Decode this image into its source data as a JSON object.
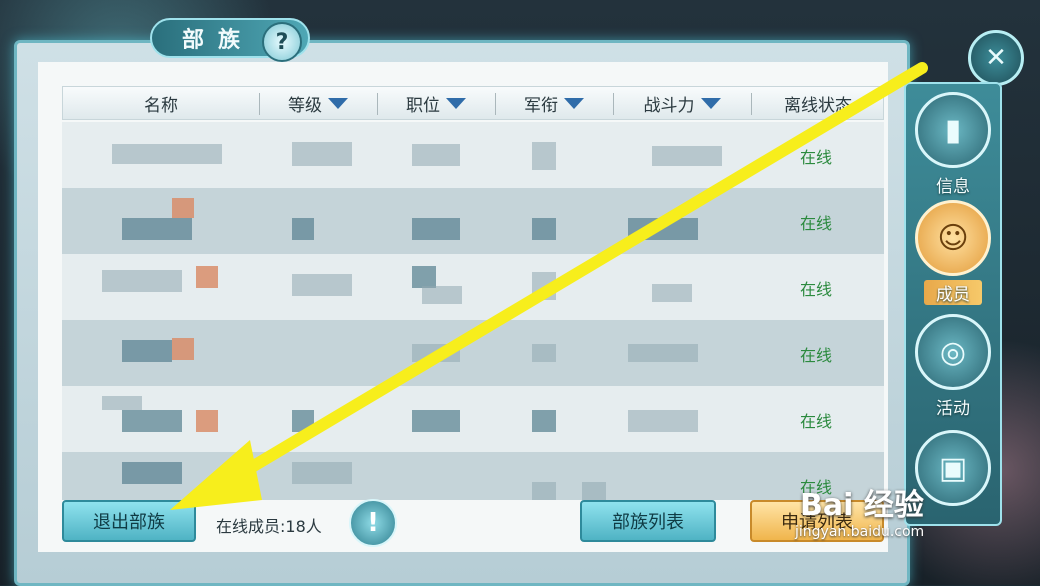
{
  "window": {
    "title": "部族",
    "help_icon": "?"
  },
  "table": {
    "headers": [
      {
        "label": "名称",
        "sortable": false
      },
      {
        "label": "等级",
        "sortable": true
      },
      {
        "label": "职位",
        "sortable": true
      },
      {
        "label": "军衔",
        "sortable": true
      },
      {
        "label": "战斗力",
        "sortable": true
      },
      {
        "label": "离线状态",
        "sortable": false
      }
    ],
    "rows": [
      {
        "status": "在线"
      },
      {
        "status": "在线"
      },
      {
        "status": "在线"
      },
      {
        "status": "在线"
      },
      {
        "status": "在线"
      },
      {
        "status": "在线"
      }
    ]
  },
  "bottom": {
    "leave_button": "退出部族",
    "online_count": "在线成员:18人",
    "info_icon": "!",
    "tribe_list_button": "部族列表",
    "apply_list_button": "申请列表"
  },
  "side_tabs": [
    {
      "label": "信息",
      "icon": "info-tab-icon",
      "active": false
    },
    {
      "label": "成员",
      "icon": "members-tab-icon",
      "active": true
    },
    {
      "label": "活动",
      "icon": "activity-tab-icon",
      "active": false
    },
    {
      "label": "",
      "icon": "gift-tab-icon",
      "active": false
    }
  ],
  "watermark": {
    "brand": "Bai 经验",
    "url": "jingyan.baidu.com"
  },
  "colors": {
    "online": "#2b8a3e",
    "accent": "#4fb3c4",
    "gold": "#f0b54c",
    "arrow": "#f7ee1c"
  }
}
